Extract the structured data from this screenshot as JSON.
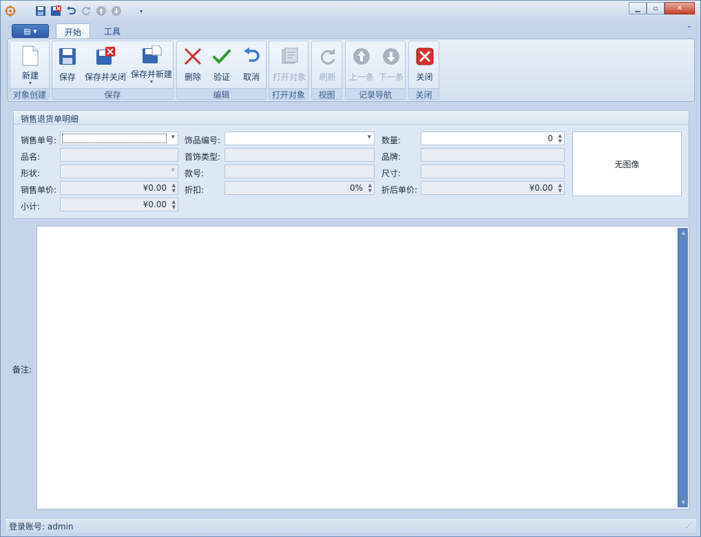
{
  "titlebar": {
    "quick_access_icons": [
      "app-orb-icon",
      "save-icon",
      "save-close-icon",
      "undo-icon",
      "redo-icon",
      "up-icon",
      "down-icon",
      "customize-icon"
    ]
  },
  "tabs": [
    {
      "label": "开始",
      "active": true
    },
    {
      "label": "工具",
      "active": false
    }
  ],
  "ribbon": {
    "groups": [
      {
        "title": "对象创建",
        "buttons": [
          {
            "label": "新建",
            "icon": "new-document-icon",
            "enabled": true,
            "dropdown": true
          }
        ]
      },
      {
        "title": "保存",
        "buttons": [
          {
            "label": "保存",
            "icon": "save-icon",
            "enabled": true
          },
          {
            "label": "保存并关闭",
            "icon": "save-close-icon",
            "enabled": true
          },
          {
            "label": "保存并新建",
            "icon": "save-new-icon",
            "enabled": true,
            "dropdown": true
          }
        ]
      },
      {
        "title": "编辑",
        "buttons": [
          {
            "label": "删除",
            "icon": "delete-x-icon",
            "enabled": true
          },
          {
            "label": "验证",
            "icon": "check-icon",
            "enabled": true
          },
          {
            "label": "取消",
            "icon": "undo-icon",
            "enabled": true
          }
        ]
      },
      {
        "title": "打开对象",
        "buttons": [
          {
            "label": "打开对象",
            "icon": "open-object-icon",
            "enabled": false
          }
        ]
      },
      {
        "title": "视图",
        "buttons": [
          {
            "label": "刷新",
            "icon": "refresh-icon",
            "enabled": false
          }
        ]
      },
      {
        "title": "记录导航",
        "buttons": [
          {
            "label": "上一条",
            "icon": "arrow-up-icon",
            "enabled": false
          },
          {
            "label": "下一条",
            "icon": "arrow-down-icon",
            "enabled": false
          }
        ]
      },
      {
        "title": "关闭",
        "buttons": [
          {
            "label": "关闭",
            "icon": "close-red-icon",
            "enabled": true
          }
        ]
      }
    ]
  },
  "form": {
    "title": "销售退货单明细",
    "sales_no": {
      "label": "销售单号:",
      "value": ""
    },
    "item_code": {
      "label": "饰品编号:",
      "value": ""
    },
    "quantity": {
      "label": "数量:",
      "value": "0"
    },
    "product_name": {
      "label": "品名:",
      "value": ""
    },
    "jewelry_type": {
      "label": "首饰类型:",
      "value": ""
    },
    "brand": {
      "label": "品牌:",
      "value": ""
    },
    "shape": {
      "label": "形状:",
      "value": ""
    },
    "style_no": {
      "label": "款号:",
      "value": ""
    },
    "size": {
      "label": "尺寸:",
      "value": ""
    },
    "unit_price": {
      "label": "销售单价:",
      "value": "¥0.00"
    },
    "discount": {
      "label": "折扣:",
      "value": "0%"
    },
    "discounted_price": {
      "label": "折后单价:",
      "value": "¥0.00"
    },
    "subtotal": {
      "label": "小计:",
      "value": "¥0.00"
    },
    "image_placeholder": "无图像",
    "remarks_label": "备注:"
  },
  "status": {
    "login_text": "登录账号: admin"
  }
}
